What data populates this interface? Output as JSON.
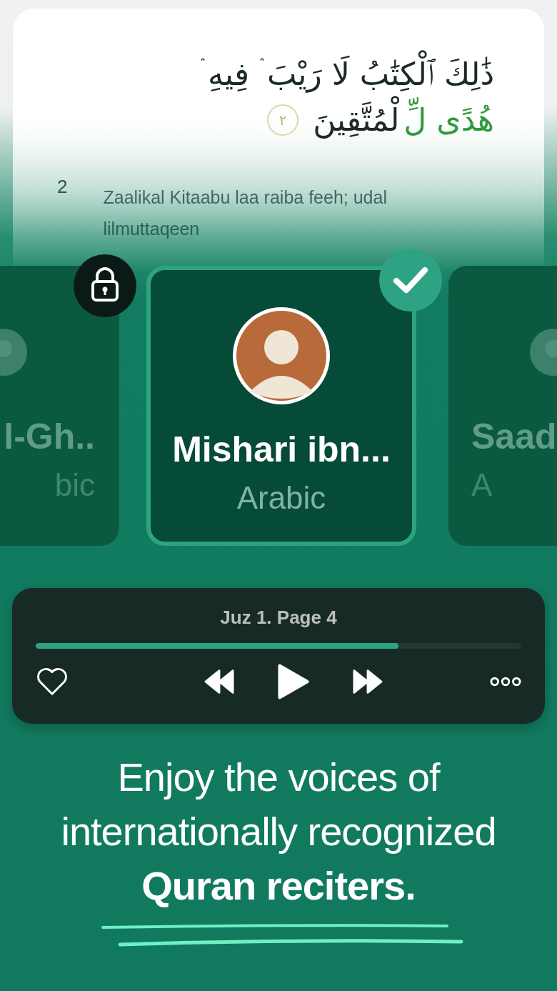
{
  "verse": {
    "arabic_lines": [
      [
        {
          "text": "ذَٰلِكَ ٱلْكِتَٰبُ لَا رَيْبَ ۛ فِيهِ ۛ",
          "color": "#1c2b26"
        }
      ],
      [
        {
          "text": "هُدًى لِّ",
          "color": "#2f9a3c"
        },
        {
          "text": "لْمُتَّقِينَ",
          "color": "#1c2b26"
        }
      ]
    ],
    "ayah_marker": "٢",
    "number": "2",
    "transliteration": "Zaalikal Kitaabu laa raiba feeh; udal lilmuttaqeen"
  },
  "reciters": [
    {
      "name": "l-Gh..",
      "language": "bic",
      "selected": false,
      "locked": true
    },
    {
      "name": "Mishari ibn...",
      "language": "Arabic",
      "selected": true,
      "locked": false
    },
    {
      "name": "Saad",
      "language": "A",
      "selected": false,
      "locked": false
    }
  ],
  "player": {
    "title": "Juz 1. Page 4",
    "level": 0.747
  },
  "tagline": "Enjoy the voices of internationally recognized **Quran reciters.**"
}
